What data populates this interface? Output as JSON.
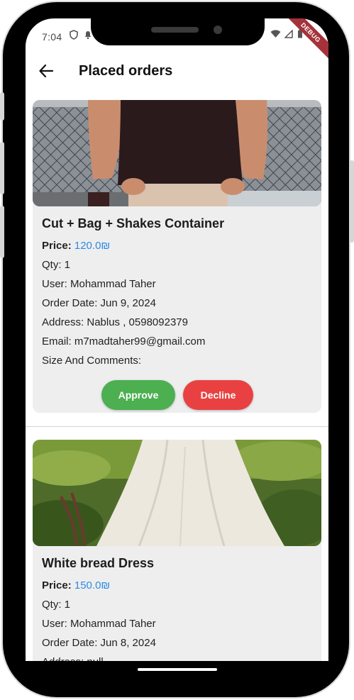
{
  "status_bar": {
    "time": "7:04",
    "left_icons": [
      "shield-icon",
      "notification-icon"
    ],
    "right_icons": [
      "wifi-icon",
      "signal-icon",
      "battery-icon"
    ],
    "debug_banner": "DEBUG"
  },
  "app_bar": {
    "back_icon": "arrow-back-icon",
    "title": "Placed orders"
  },
  "labels": {
    "price": "Price:",
    "approve": "Approve",
    "decline": "Decline"
  },
  "orders": [
    {
      "name": "Cut + Bag + Shakes Container",
      "price": "120.0₪",
      "qty": "Qty: 1",
      "user": "User: Mohammad Taher",
      "order_date": "Order Date: Jun 9, 2024",
      "address": "Address: Nablus , 0598092379",
      "email": "Email: m7madtaher99@gmail.com",
      "size_comments": "Size And Comments:"
    },
    {
      "name": "White bread Dress",
      "price": "150.0₪",
      "qty": "Qty: 1",
      "user": "User: Mohammad Taher",
      "order_date": "Order Date: Jun 8, 2024",
      "address": "Address: null"
    }
  ],
  "colors": {
    "approve": "#4caf50",
    "decline": "#e94141",
    "price": "#2f8be0",
    "card": "#eeeeef",
    "debug_banner": "#a5323a"
  }
}
